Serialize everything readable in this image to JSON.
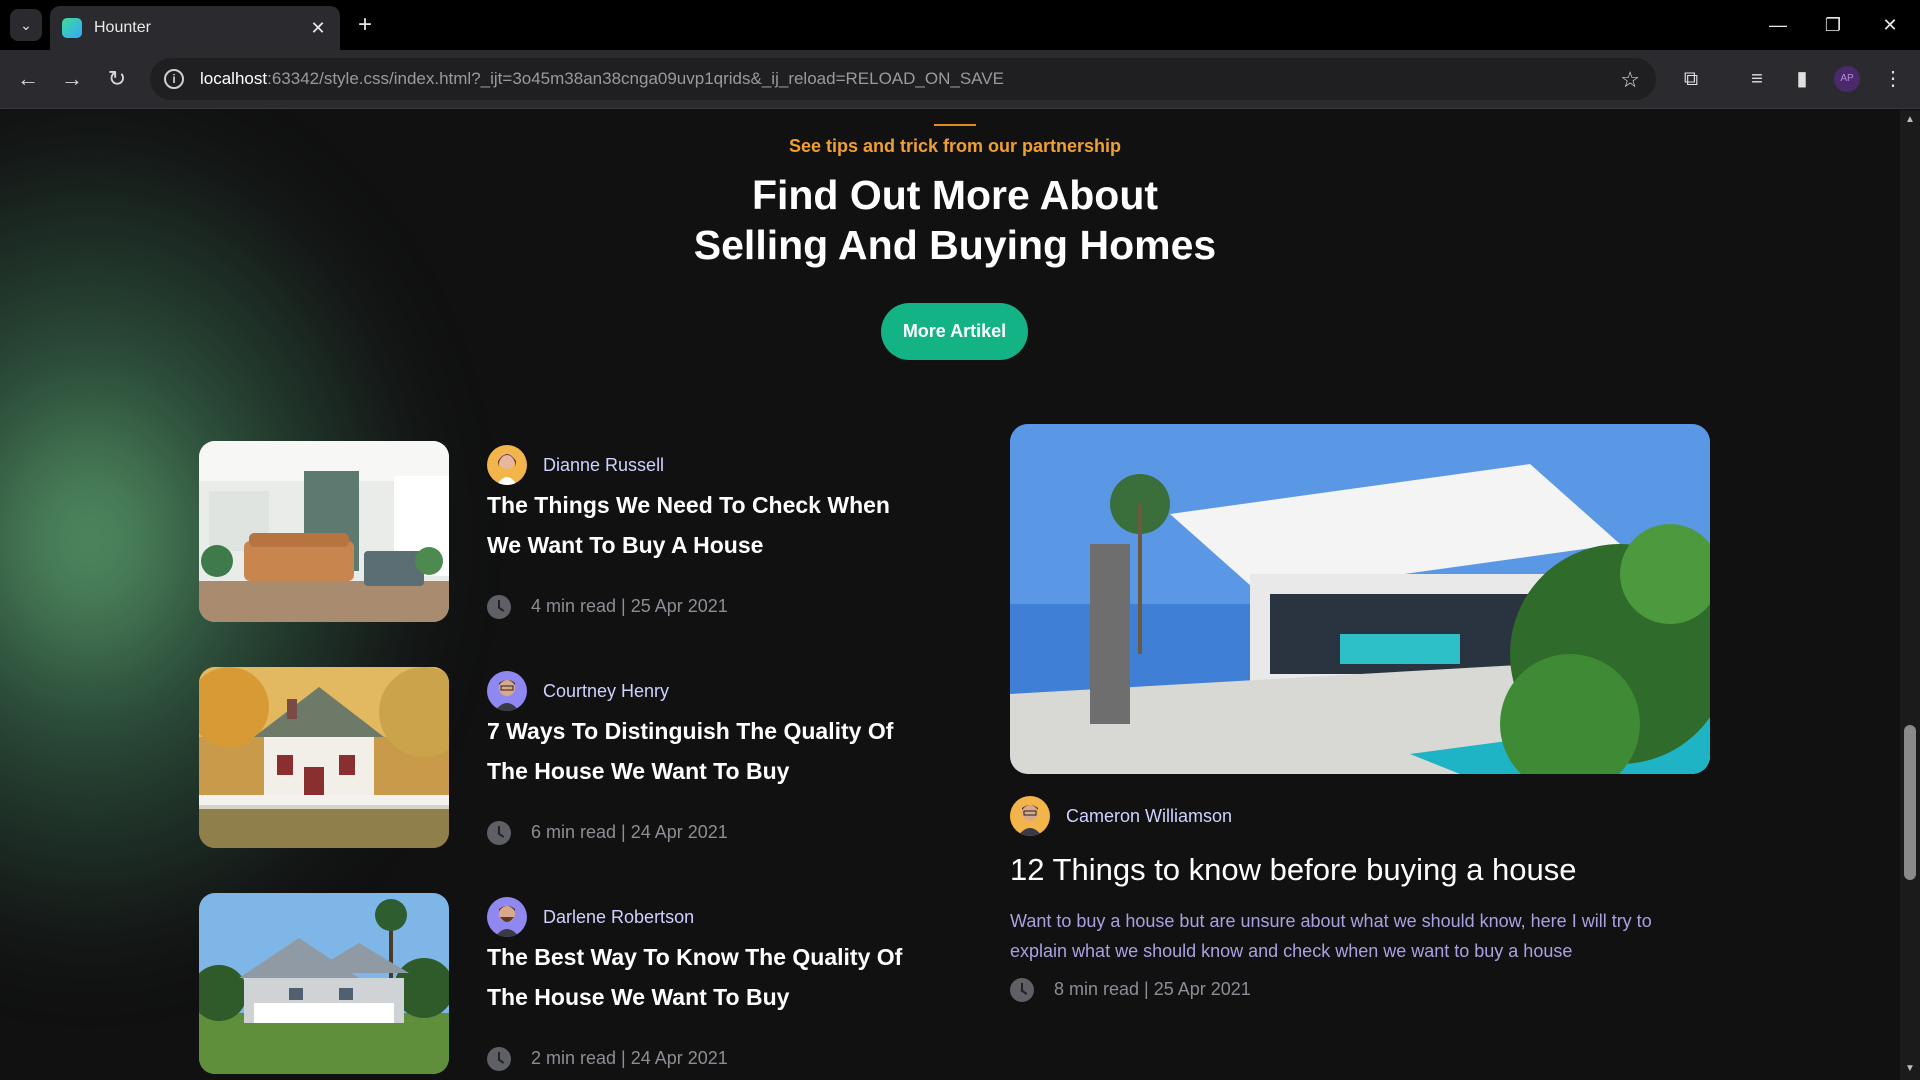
{
  "browser": {
    "tab_title": "Hounter",
    "url_host": "localhost",
    "url_rest": ":63342/style.css/index.html?_ijt=3o45m38an38cnga09uvp1qrids&_ij_reload=RELOAD_ON_SAVE",
    "profile_initials": "AP",
    "icons": [
      "tab-search-icon",
      "close-icon",
      "plus-icon",
      "back-icon",
      "forward-icon",
      "reload-icon",
      "info-icon",
      "star-icon",
      "extensions-icon",
      "media-icon",
      "sidebar-icon",
      "menu-icon",
      "minimize-icon",
      "restore-icon",
      "close-window-icon"
    ]
  },
  "section": {
    "eyebrow": "See tips and trick from our partnership",
    "headline_line1": "Find Out More About",
    "headline_line2": "Selling And Buying Homes",
    "button_label": "More Artikel"
  },
  "articles": [
    {
      "author": "Dianne Russell",
      "title": "The Things We Need To Check When We Want To Buy A House",
      "meta": "4 min read | 25 Apr 2021"
    },
    {
      "author": "Courtney Henry",
      "title": "7 Ways To Distinguish The Quality Of The House We Want To Buy",
      "meta": "6 min read | 24 Apr 2021"
    },
    {
      "author": "Darlene Robertson",
      "title": "The Best Way To Know The Quality Of The House We Want To Buy",
      "meta": "2 min read | 24 Apr 2021"
    }
  ],
  "featured": {
    "author": "Cameron Williamson",
    "title": "12 Things to know before buying a house",
    "description": "Want to buy a house but are unsure about what we should know, here I will try to explain what we should know and check when we want to buy a house",
    "meta": "8 min read | 25 Apr 2021"
  },
  "colors": {
    "accent_orange": "#f0a030",
    "button_green": "#14b386",
    "author_text": "#cfd2ff",
    "desc_text": "#a9a2e0"
  }
}
